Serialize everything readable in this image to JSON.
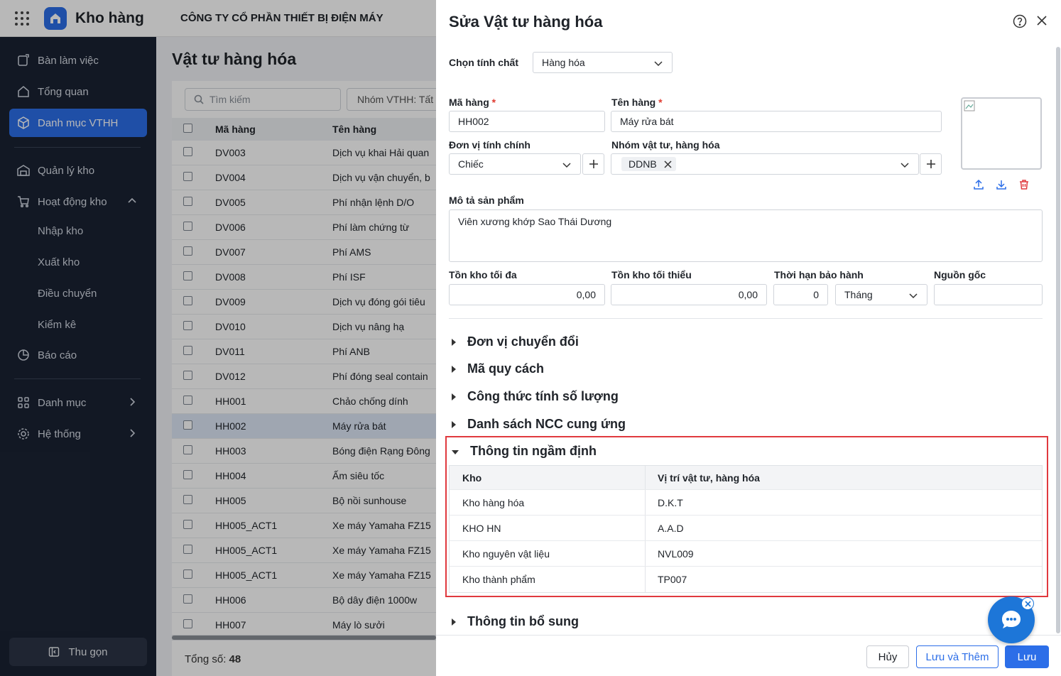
{
  "topbar": {
    "app_name": "Kho hàng",
    "company": "CÔNG TY CỔ PHẦN THIẾT BỊ ĐIỆN MÁY"
  },
  "sidebar": {
    "items": [
      {
        "label": "Bàn làm việc"
      },
      {
        "label": "Tổng quan"
      },
      {
        "label": "Danh mục VTHH"
      },
      {
        "label": "Quản lý kho"
      },
      {
        "label": "Hoạt động kho"
      },
      {
        "label": "Danh mục"
      },
      {
        "label": "Hệ thống"
      }
    ],
    "sub_items": [
      "Nhập kho",
      "Xuất kho",
      "Điều chuyển",
      "Kiểm kê",
      "Báo cáo"
    ],
    "collapse_label": "Thu gọn"
  },
  "list": {
    "title": "Vật tư hàng hóa",
    "search_placeholder": "Tìm kiếm",
    "group_filter": "Nhóm VTHH: Tất",
    "col_code": "Mã hàng",
    "col_name": "Tên hàng",
    "rows": [
      {
        "code": "DV003",
        "name": "Dịch vụ khai Hải quan"
      },
      {
        "code": "DV004",
        "name": "Dịch vụ vận chuyển, b"
      },
      {
        "code": "DV005",
        "name": "Phí nhận lệnh D/O"
      },
      {
        "code": "DV006",
        "name": "Phí làm chứng từ"
      },
      {
        "code": "DV007",
        "name": "Phí AMS"
      },
      {
        "code": "DV008",
        "name": "Phí ISF"
      },
      {
        "code": "DV009",
        "name": "Dịch vụ đóng gói tiêu"
      },
      {
        "code": "DV010",
        "name": "Dịch vụ nâng hạ"
      },
      {
        "code": "DV011",
        "name": "Phí ANB"
      },
      {
        "code": "DV012",
        "name": "Phí đóng seal contain"
      },
      {
        "code": "HH001",
        "name": "Chảo chống dính"
      },
      {
        "code": "HH002",
        "name": "Máy rửa bát"
      },
      {
        "code": "HH003",
        "name": "Bóng điện Rạng Đông"
      },
      {
        "code": "HH004",
        "name": "Ấm siêu tốc"
      },
      {
        "code": "HH005",
        "name": "Bộ nồi sunhouse"
      },
      {
        "code": "HH005_ACT1",
        "name": "Xe máy Yamaha FZ15"
      },
      {
        "code": "HH005_ACT1",
        "name": "Xe máy Yamaha FZ15"
      },
      {
        "code": "HH005_ACT1",
        "name": "Xe máy Yamaha FZ15"
      },
      {
        "code": "HH006",
        "name": "Bộ dây điện 1000w"
      },
      {
        "code": "HH007",
        "name": "Máy lò sưởi"
      }
    ],
    "total_label": "Tổng số:",
    "total_value": "48"
  },
  "drawer": {
    "title": "Sửa Vật tư hàng hóa",
    "property_label": "Chọn tính chất",
    "property_value": "Hàng hóa",
    "code_label": "Mã hàng",
    "code_value": "HH002",
    "name_label": "Tên hàng",
    "name_value": "Máy rửa bát",
    "unit_label": "Đơn vị tính chính",
    "unit_value": "Chiếc",
    "group_label": "Nhóm vật tư, hàng hóa",
    "group_tag": "DDNB",
    "desc_label": "Mô tả sản phẩm",
    "desc_value": "Viên xương khớp Sao Thái Dương",
    "max_stock_label": "Tồn kho tối đa",
    "max_stock_value": "0,00",
    "min_stock_label": "Tồn kho tối thiểu",
    "min_stock_value": "0,00",
    "warranty_label": "Thời hạn bảo hành",
    "warranty_value": "0",
    "warranty_unit": "Tháng",
    "origin_label": "Nguồn gốc",
    "origin_value": "",
    "sections": [
      "Đơn vị chuyển đổi",
      "Mã quy cách",
      "Công thức tính số lượng",
      "Danh sách NCC cung ứng",
      "Thông tin ngầm định",
      "Thông tin bổ sung"
    ],
    "default_table": {
      "col_warehouse": "Kho",
      "col_location": "Vị trí vật tư, hàng hóa",
      "rows": [
        {
          "warehouse": "Kho hàng hóa",
          "location": "D.K.T"
        },
        {
          "warehouse": "KHO HN",
          "location": "A.A.D"
        },
        {
          "warehouse": "Kho nguyên vật liệu",
          "location": "NVL009"
        },
        {
          "warehouse": "Kho thành phẩm",
          "location": "TP007"
        }
      ]
    },
    "buttons": {
      "cancel": "Hủy",
      "save_add": "Lưu và Thêm",
      "save": "Lưu"
    }
  },
  "colors": {
    "primary": "#2c6ee8",
    "sidebar_bg": "#1a2233",
    "highlight": "#e0393e"
  }
}
